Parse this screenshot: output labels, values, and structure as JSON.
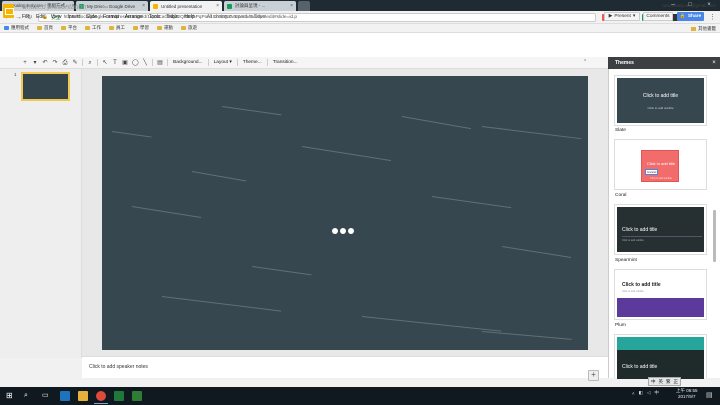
{
  "browser": {
    "tabs": [
      {
        "label": "Kaling Kaiyuan - 重組方式...",
        "color": "#3b5998"
      },
      {
        "label": "My Drive - Google Drive",
        "color": "#1aa260"
      },
      {
        "label": "Untitled presentation",
        "color": "#f4b400",
        "active": true
      },
      {
        "label": "討論與呈現 - ...",
        "color": "#0f9d58"
      }
    ],
    "omnibox": {
      "secure_label": "安全",
      "url": "https://docs.google.com/presentation/d/1vpSCaGFfgz2QNBzhPqPon1Sn0ktNZVEpecuc5dalpo/edit#slide=id.p"
    },
    "bookmarks": [
      "應用程式",
      "首頁",
      "平台",
      "工作",
      "員工",
      "學習",
      "運動",
      "旅遊"
    ],
    "other_bookmarks": "其他書籤"
  },
  "docs": {
    "title": "Untitled presentation",
    "account": "taiwankaiyuan@gmail.com",
    "menu": [
      "File",
      "Edit",
      "View",
      "Insert",
      "Slide",
      "Format",
      "Arrange",
      "Tools",
      "Table",
      "Help"
    ],
    "saved_status": "All changes saved in Drive",
    "present_label": "Present",
    "comments_label": "Comments",
    "share_label": "Share",
    "toolbar": {
      "background": "Background...",
      "layout": "Layout",
      "theme": "Theme...",
      "transition": "Transition..."
    },
    "slide_number": "1",
    "notes_placeholder": "Click to add speaker notes"
  },
  "themes": {
    "header": "Themes",
    "items": [
      {
        "name": "Slate",
        "title_text": "Click to add title",
        "sub_text": "Click to add subtitle",
        "bg": "#37474f",
        "fg": "#ffffff"
      },
      {
        "name": "Coral",
        "title_text": "Click to add title",
        "sub_text": "Click to add subtitle",
        "chip": "Cancel",
        "bg": "#ffffff",
        "accent": "#f36c6c"
      },
      {
        "name": "Spearmint",
        "title_text": "Click to add title",
        "sub_text": "Click to add subtitle",
        "bg": "#263033",
        "fg": "#ffffff"
      },
      {
        "name": "Plum",
        "title_text": "Click to add title",
        "sub_text": "Click to add subtitle",
        "bg": "#ffffff",
        "accent": "#5b3a9c"
      },
      {
        "name": "",
        "title_text": "Click to add title",
        "bg": "#1f2a2a",
        "accent": "#26a69a"
      }
    ]
  },
  "taskbar": {
    "time": "06:55",
    "am_pm": "上午",
    "date": "2017/9/7",
    "ime_labels": [
      "中",
      "英",
      "繁",
      "正"
    ]
  }
}
